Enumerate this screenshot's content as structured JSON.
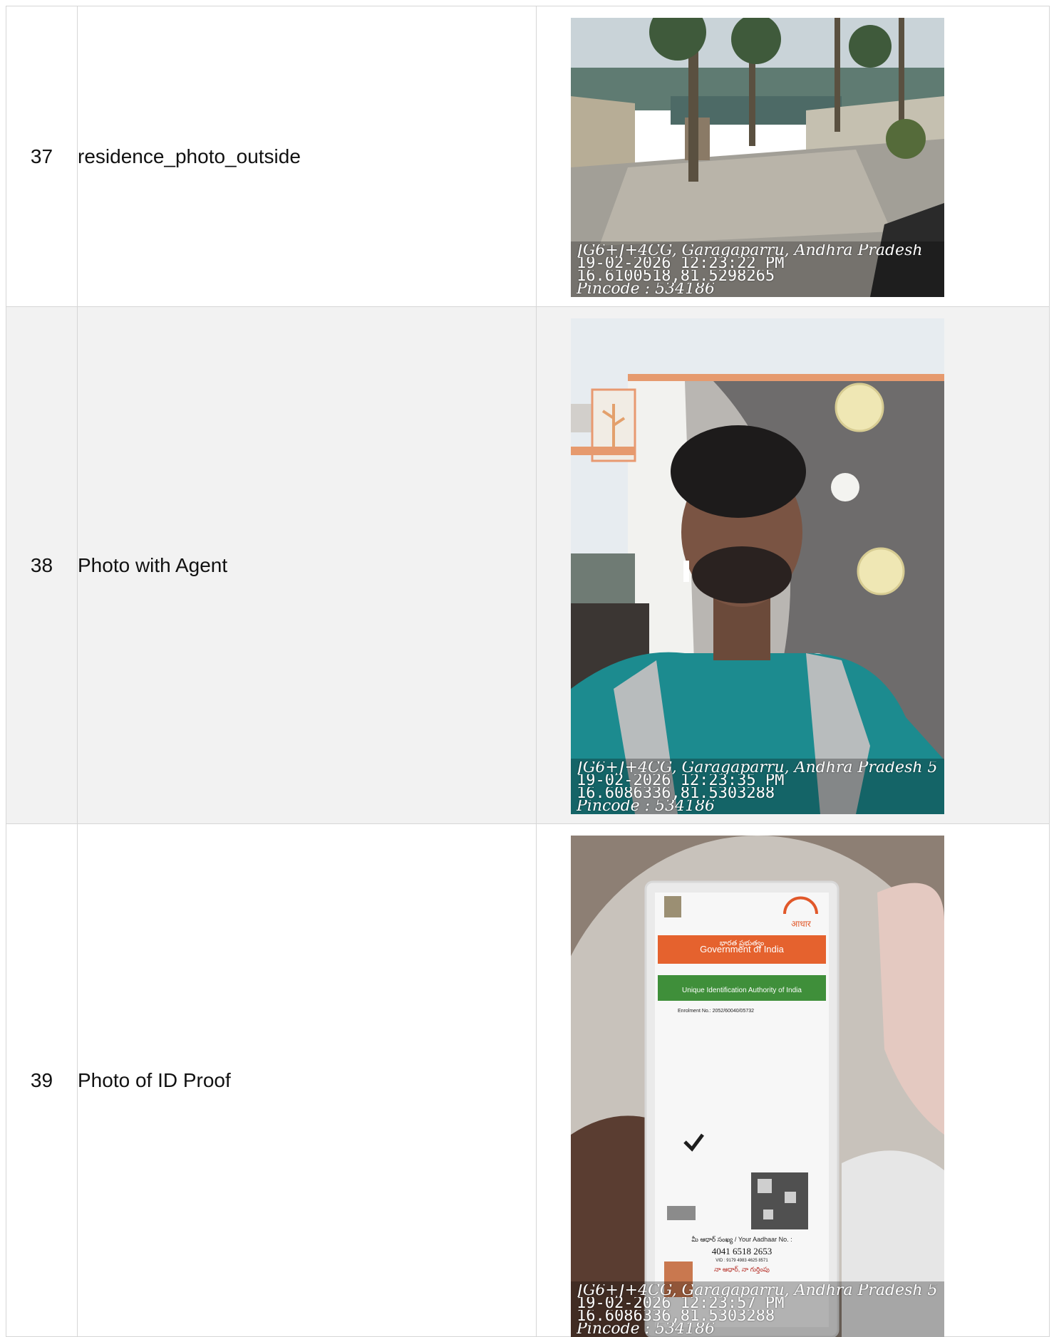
{
  "rows": [
    {
      "number": "37",
      "label": "residence_photo_outside",
      "photo": {
        "icon": "residence-outside-photo",
        "location": "JG6+J+4CG, Garagaparru, Andhra Pradesh",
        "datetime": "19-02-2026 12:23:22 PM",
        "coordinates": "16.6100518,81.5298265",
        "pincode": "Pincode : 534186"
      }
    },
    {
      "number": "38",
      "label": "Photo with Agent",
      "photo": {
        "icon": "agent-selfie-photo",
        "location": "JG6+J+4CG, Garagaparru, Andhra Pradesh 5",
        "datetime": "19-02-2026 12:23:35 PM",
        "coordinates": "16.6086336,81.5303288",
        "pincode": "Pincode : 534186"
      }
    },
    {
      "number": "39",
      "label": "Photo of ID Proof",
      "photo": {
        "icon": "id-proof-photo",
        "location": "JG6+J+4CG, Garagaparru, Andhra Pradesh 5",
        "datetime": "19-02-2026 12:23:57 PM",
        "coordinates": "16.6086336,81.5303288",
        "pincode": "Pincode : 534186",
        "card": {
          "header_telugu": "భారత ప్రభుత్వం",
          "header": "Government of India",
          "authority": "Unique Identification Authority of India",
          "enrolment": "Enrolment No.: 2052/60040/05732",
          "number_label": "మీ ఆధార్ సంఖ్య / Your Aadhaar No. :",
          "number": "4041 6518 2653",
          "vid": "VID : 9179 4983 4625 8571",
          "tagline": "నా ఆధార్, నా గుర్తింపు",
          "brand": "आधार"
        }
      }
    }
  ]
}
